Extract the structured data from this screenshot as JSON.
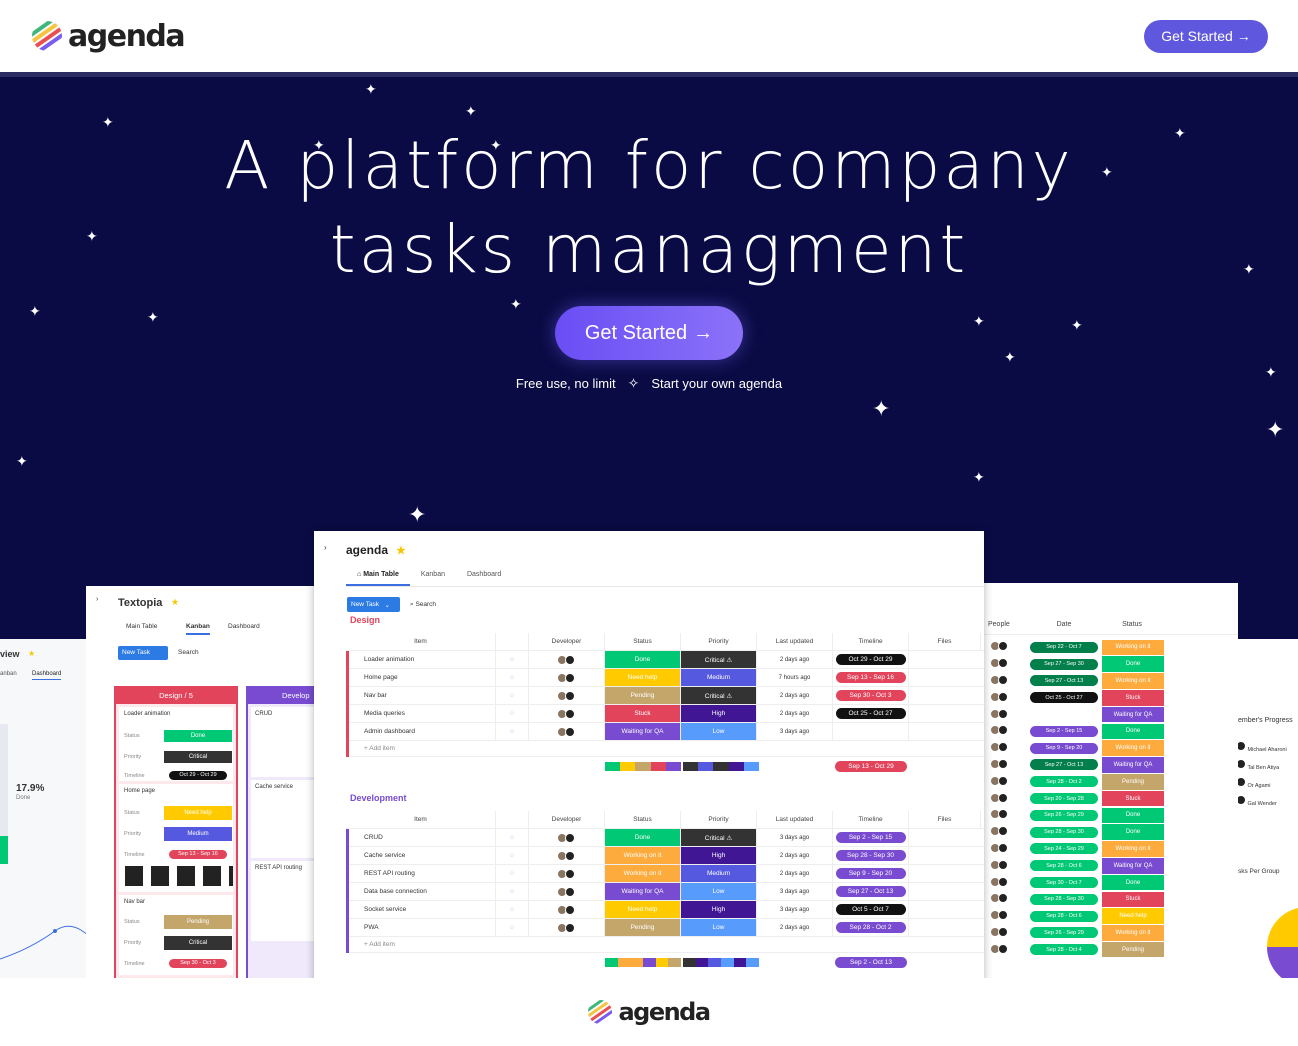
{
  "header": {
    "logo_text": "agenda",
    "cta_label": "Get Started",
    "cta_arrow": "→"
  },
  "hero": {
    "title_line1": "A platform for company",
    "title_line2": "tasks managment",
    "cta_label": "Get Started",
    "cta_arrow": "→",
    "sub_left": "Free use, no limit",
    "sub_right": "Start your own agenda"
  },
  "main_board": {
    "title": "agenda",
    "tabs": [
      "Main Table",
      "Kanban",
      "Dashboard"
    ],
    "new_task": "New Task",
    "search": "Search",
    "columns": [
      "Item",
      "Developer",
      "Status",
      "Priority",
      "Last updated",
      "Timeline",
      "Files"
    ],
    "add_item": "+ Add item",
    "groups": [
      {
        "name": "Design",
        "color": "#e2445c",
        "rows": [
          {
            "item": "Loader animation",
            "status": "Done",
            "status_color": "#00c875",
            "priority": "Critical ⚠",
            "priority_color": "#333333",
            "updated": "2 days ago",
            "timeline": "Oct 29 - Oct 29",
            "timeline_color": "#111111"
          },
          {
            "item": "Home page",
            "status": "Need help",
            "status_color": "#ffcb00",
            "priority": "Medium",
            "priority_color": "#5559df",
            "updated": "7 hours ago",
            "timeline": "Sep 13 - Sep 16",
            "timeline_color": "#e2445c"
          },
          {
            "item": "Nav bar",
            "status": "Pending",
            "status_color": "#c4a56a",
            "priority": "Critical ⚠",
            "priority_color": "#333333",
            "updated": "2 days ago",
            "timeline": "Sep 30 - Oct 3",
            "timeline_color": "#e2445c"
          },
          {
            "item": "Media queries",
            "status": "Stuck",
            "status_color": "#e2445c",
            "priority": "High",
            "priority_color": "#401694",
            "updated": "2 days ago",
            "timeline": "Oct 25 - Oct 27",
            "timeline_color": "#111111"
          },
          {
            "item": "Admin dashboard",
            "status": "Waiting for QA",
            "status_color": "#784bd1",
            "priority": "Low",
            "priority_color": "#579bfc",
            "updated": "3 days ago",
            "timeline": "",
            "timeline_color": "#ffffff"
          }
        ],
        "summary_timeline": "Sep 13 - Oct 29"
      },
      {
        "name": "Development",
        "color": "#784bd1",
        "rows": [
          {
            "item": "CRUD",
            "status": "Done",
            "status_color": "#00c875",
            "priority": "Critical ⚠",
            "priority_color": "#333333",
            "updated": "3 days ago",
            "timeline": "Sep 2 - Sep 15",
            "timeline_color": "#784bd1"
          },
          {
            "item": "Cache service",
            "status": "Working on it",
            "status_color": "#fdab3d",
            "priority": "High",
            "priority_color": "#401694",
            "updated": "2 days ago",
            "timeline": "Sep 28 - Sep 30",
            "timeline_color": "#784bd1"
          },
          {
            "item": "REST API routing",
            "status": "Working on it",
            "status_color": "#fdab3d",
            "priority": "Medium",
            "priority_color": "#5559df",
            "updated": "2 days ago",
            "timeline": "Sep 9 - Sep 20",
            "timeline_color": "#784bd1"
          },
          {
            "item": "Data base connection",
            "status": "Waiting for QA",
            "status_color": "#784bd1",
            "priority": "Low",
            "priority_color": "#579bfc",
            "updated": "3 days ago",
            "timeline": "Sep 27 - Oct 13",
            "timeline_color": "#784bd1"
          },
          {
            "item": "Socket service",
            "status": "Need help",
            "status_color": "#ffcb00",
            "priority": "High",
            "priority_color": "#401694",
            "updated": "3 days ago",
            "timeline": "Oct 5 - Oct 7",
            "timeline_color": "#111111"
          },
          {
            "item": "PWA",
            "status": "Pending",
            "status_color": "#c4a56a",
            "priority": "Low",
            "priority_color": "#579bfc",
            "updated": "2 days ago",
            "timeline": "Sep 28 - Oct 2",
            "timeline_color": "#784bd1"
          }
        ],
        "summary_timeline": "Sep 2 - Oct 13"
      }
    ]
  },
  "kanban_board": {
    "title": "Textopia",
    "tabs": [
      "Main Table",
      "Kanban",
      "Dashboard"
    ],
    "new_task": "New Task",
    "search": "Search",
    "col1_title": "Design / 5",
    "col2_title": "Develop",
    "cards": [
      {
        "name": "Loader animation",
        "status": "Done",
        "status_color": "#00c875",
        "priority": "Critical",
        "priority_color": "#333333",
        "timeline": "Oct 29 - Oct 29",
        "timeline_color": "#111111"
      },
      {
        "name": "Home page",
        "status": "Need help",
        "status_color": "#ffcb00",
        "priority": "Medium",
        "priority_color": "#5559df",
        "timeline": "Sep 13 - Sep 16",
        "timeline_color": "#e2445c"
      },
      {
        "name": "Nav bar",
        "status": "Pending",
        "status_color": "#c4a56a",
        "priority": "Critical",
        "priority_color": "#333333",
        "timeline": "Sep 30 - Oct 3",
        "timeline_color": "#e2445c"
      }
    ],
    "col2_cards": [
      "CRUD",
      "Cache service",
      "REST API routing"
    ],
    "field_labels": [
      "Status",
      "Priority",
      "Timeline"
    ]
  },
  "overview_board": {
    "title": "view",
    "tabs": [
      "anban",
      "Dashboard"
    ],
    "percent": "17.9%",
    "percent_label": "Done"
  },
  "right_board": {
    "columns": [
      "People",
      "Date",
      "Status"
    ],
    "rows": [
      {
        "date": "Sep 22 - Oct 7",
        "date_color": "#037f4c",
        "status": "Working on it",
        "status_color": "#fdab3d"
      },
      {
        "date": "Sep 27 - Sep 30",
        "date_color": "#037f4c",
        "status": "Done",
        "status_color": "#00c875"
      },
      {
        "date": "Sep 27 - Oct 13",
        "date_color": "#037f4c",
        "status": "Working on it",
        "status_color": "#fdab3d"
      },
      {
        "date": "Oct 25 - Oct 27",
        "date_color": "#111111",
        "status": "Stuck",
        "status_color": "#e2445c"
      },
      {
        "date": "",
        "date_color": "#ffffff",
        "status": "Waiting for QA",
        "status_color": "#784bd1"
      },
      {
        "date": "Sep 2 - Sep 15",
        "date_color": "#784bd1",
        "status": "Done",
        "status_color": "#00c875"
      },
      {
        "date": "Sep 9 - Sep 20",
        "date_color": "#784bd1",
        "status": "Working on it",
        "status_color": "#fdab3d"
      },
      {
        "date": "Sep 27 - Oct 13",
        "date_color": "#037f4c",
        "status": "Waiting for QA",
        "status_color": "#784bd1"
      },
      {
        "date": "Sep 28 - Oct 2",
        "date_color": "#00c875",
        "status": "Pending",
        "status_color": "#c4a56a"
      },
      {
        "date": "Sep 20 - Sep 28",
        "date_color": "#00c875",
        "status": "Stuck",
        "status_color": "#e2445c"
      },
      {
        "date": "Sep 26 - Sep 29",
        "date_color": "#00c875",
        "status": "Done",
        "status_color": "#00c875"
      },
      {
        "date": "Sep 28 - Sep 30",
        "date_color": "#00c875",
        "status": "Done",
        "status_color": "#00c875"
      },
      {
        "date": "Sep 24 - Sep 29",
        "date_color": "#00c875",
        "status": "Working on it",
        "status_color": "#fdab3d"
      },
      {
        "date": "Sep 28 - Oct 6",
        "date_color": "#00c875",
        "status": "Waiting for QA",
        "status_color": "#784bd1"
      },
      {
        "date": "Sep 30 - Oct 7",
        "date_color": "#00c875",
        "status": "Done",
        "status_color": "#00c875"
      },
      {
        "date": "Sep 28 - Sep 30",
        "date_color": "#00c875",
        "status": "Stuck",
        "status_color": "#e2445c"
      },
      {
        "date": "Sep 28 - Oct 6",
        "date_color": "#00c875",
        "status": "Need help",
        "status_color": "#ffcb00"
      },
      {
        "date": "Sep 26 - Sep 29",
        "date_color": "#00c875",
        "status": "Working on it",
        "status_color": "#fdab3d"
      },
      {
        "date": "Sep 28 - Oct 4",
        "date_color": "#00c875",
        "status": "Pending",
        "status_color": "#c4a56a"
      }
    ]
  },
  "progress_board": {
    "title": "ember's Progress",
    "members": [
      "Michael Aharoni",
      "Tal Ben Atiya",
      "Or Agami",
      "Gal Wender"
    ],
    "tasks_label": "sks Per Group"
  },
  "footer": {
    "logo_text": "agenda"
  },
  "colors": {
    "hero_bg": "#0a0b44",
    "accent": "#5f58de"
  }
}
